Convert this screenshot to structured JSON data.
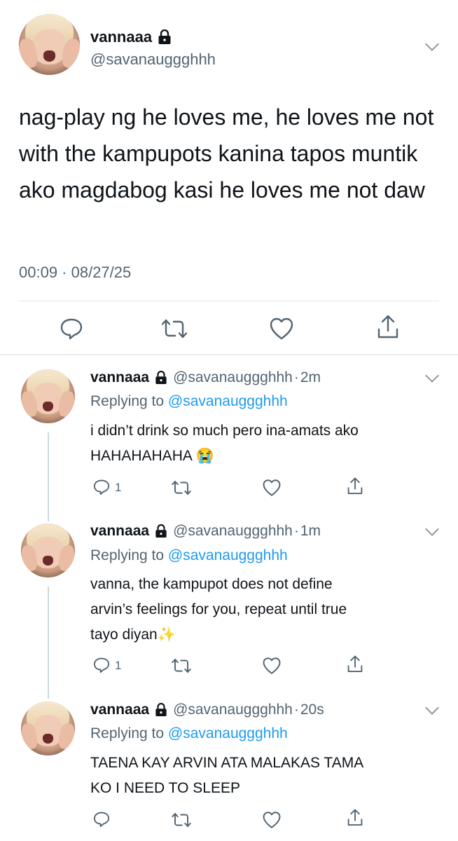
{
  "main": {
    "name": "vannaaa",
    "handle": "@savanauggghhh",
    "text": "nag-play ng he loves me, he loves me not with the kampupots kanina tapos muntik ako magdabog kasi he loves me not daw",
    "timestamp": "00:09 · 08/27/25",
    "icons": [
      "reply-icon",
      "retweet-icon",
      "like-icon",
      "share-icon"
    ]
  },
  "replies": [
    {
      "name": "vannaaa",
      "handle": "@savanauggghhh",
      "time": "2m",
      "replying_prefix": "Replying to",
      "replying_to": "@savanauggghhh",
      "text_line1": "i didn’t drink so much pero ina-amats ako",
      "text_line2": "HAHAHAHAHA 😭",
      "reply_count": "1"
    },
    {
      "name": "vannaaa",
      "handle": "@savanauggghhh",
      "time": "1m",
      "replying_prefix": "Replying to",
      "replying_to": "@savanauggghhh",
      "text_line1": "vanna, the kampupot does not define",
      "text_line2": "arvin’s feelings for you, repeat until true",
      "text_line3": "tayo diyan✨",
      "reply_count": "1"
    },
    {
      "name": "vannaaa",
      "handle": "@savanauggghhh",
      "time": "20s",
      "replying_prefix": "Replying to",
      "replying_to": "@savanauggghhh",
      "text_line1": "TAENA KAY ARVIN ATA MALAKAS TAMA",
      "text_line2": "KO I NEED TO SLEEP",
      "reply_count": ""
    }
  ],
  "colors": {
    "text": "#0f1419",
    "secondary": "#536471",
    "link": "#1d9bf0",
    "divider": "#e1e8ed",
    "icon": "#536471"
  }
}
